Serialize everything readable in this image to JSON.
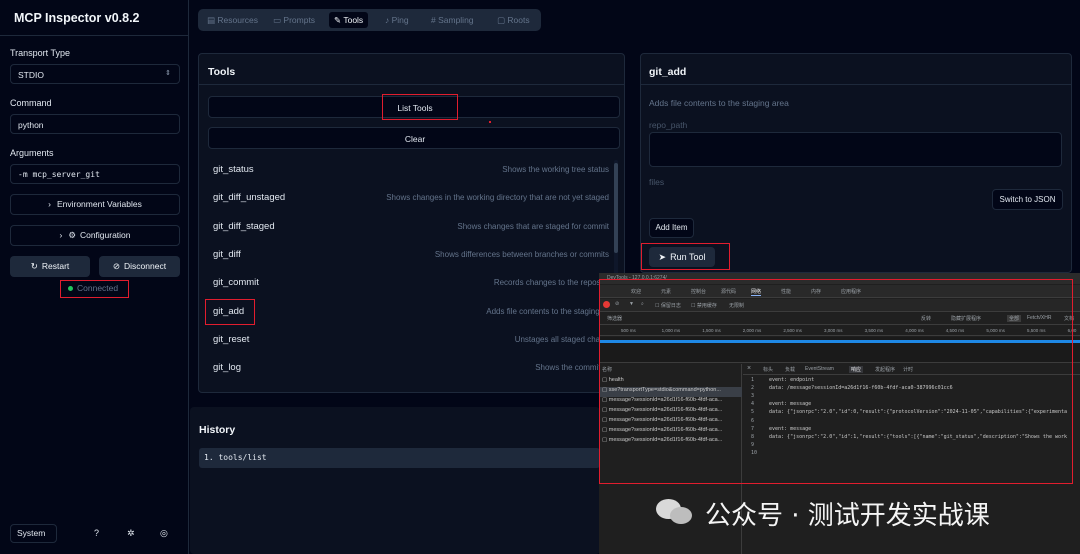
{
  "app": {
    "title": "MCP Inspector v0.8.2"
  },
  "sidebar": {
    "transport_label": "Transport Type",
    "transport_value": "STDIO",
    "command_label": "Command",
    "command_value": "python",
    "arguments_label": "Arguments",
    "arguments_value": "-m mcp_server_git",
    "env_button": "Environment Variables",
    "config_button": "Configuration",
    "restart_button": "Restart",
    "disconnect_button": "Disconnect",
    "status": "Connected",
    "theme_select": "System"
  },
  "tabs": [
    {
      "label": "Resources",
      "icon": "file-icon"
    },
    {
      "label": "Prompts",
      "icon": "chat-icon"
    },
    {
      "label": "Tools",
      "icon": "wrench-icon"
    },
    {
      "label": "Ping",
      "icon": "bell-icon"
    },
    {
      "label": "Sampling",
      "icon": "hash-icon"
    },
    {
      "label": "Roots",
      "icon": "folder-icon"
    }
  ],
  "tools_panel": {
    "title": "Tools",
    "list_button": "List Tools",
    "clear_button": "Clear",
    "items": [
      {
        "name": "git_status",
        "description": "Shows the working tree status"
      },
      {
        "name": "git_diff_unstaged",
        "description": "Shows changes in the working directory that are not yet staged"
      },
      {
        "name": "git_diff_staged",
        "description": "Shows changes that are staged for commit"
      },
      {
        "name": "git_diff",
        "description": "Shows differences between branches or commits"
      },
      {
        "name": "git_commit",
        "description": "Records changes to the reposito"
      },
      {
        "name": "git_add",
        "description": "Adds file contents to the staging ar"
      },
      {
        "name": "git_reset",
        "description": "Unstages all staged chang"
      },
      {
        "name": "git_log",
        "description": "Shows the commit lo"
      }
    ]
  },
  "history": {
    "title": "History",
    "items": [
      "1. tools/list"
    ]
  },
  "detail": {
    "title": "git_add",
    "description": "Adds file contents to the staging area",
    "repo_path_label": "repo_path",
    "files_label": "files",
    "switch_json_button": "Switch to JSON",
    "add_item_button": "Add Item",
    "run_button": "Run Tool"
  },
  "devtools": {
    "url_fragment": "DevTools - 127.0.0.1:6274/",
    "tabs": [
      "欢迎",
      "元素",
      "控制台",
      "源代码",
      "网络",
      "性能",
      "内存",
      "应用程序"
    ],
    "active_tab": "网络",
    "options": [
      "保留日志",
      "禁用缓存",
      "无限制"
    ],
    "filter_placeholder": "筛选器",
    "filter_options": [
      "反转",
      "隐藏扩展程序",
      "全部",
      "Fetch/XHR",
      "文档"
    ],
    "ticks": [
      "500 ms",
      "1,000 ms",
      "1,500 ms",
      "2,000 ms",
      "2,500 ms",
      "3,000 ms",
      "3,500 ms",
      "4,000 ms",
      "4,500 ms",
      "5,000 ms",
      "5,500 ms",
      "6,00"
    ],
    "name_header": "名称",
    "requests": [
      "health",
      "sse?transportType=stdio&command=python...",
      "message?sessionId=a26d1f16-f60b-4fdf-aca...",
      "message?sessionId=a26d1f16-f60b-4fdf-aca...",
      "message?sessionId=a26d1f16-f60b-4fdf-aca...",
      "message?sessionId=a26d1f16-f60b-4fdf-aca...",
      "message?sessionId=a26d1f16-f60b-4fdf-aca..."
    ],
    "detail_tabs": [
      "标头",
      "负载",
      "EventStream",
      "响应",
      "发起程序",
      "计时"
    ],
    "active_detail_tab": "响应",
    "response_lines": [
      {
        "n": "1",
        "text": "event: endpoint"
      },
      {
        "n": "2",
        "text": "data: /message?sessionId=a26d1f16-f60b-4fdf-aca0-387996c01cc6"
      },
      {
        "n": "3",
        "text": ""
      },
      {
        "n": "4",
        "text": "event: message"
      },
      {
        "n": "5",
        "text": "data: {\"jsonrpc\":\"2.0\",\"id\":0,\"result\":{\"protocolVersion\":\"2024-11-05\",\"capabilities\":{\"experimenta"
      },
      {
        "n": "6",
        "text": ""
      },
      {
        "n": "7",
        "text": "event: message"
      },
      {
        "n": "8",
        "text": "data: {\"jsonrpc\":\"2.0\",\"id\":1,\"result\":{\"tools\":[{\"name\":\"git_status\",\"description\":\"Shows the work"
      },
      {
        "n": "9",
        "text": ""
      },
      {
        "n": "10",
        "text": ""
      }
    ]
  },
  "watermark": {
    "text": "公众号 · 测试开发实战课"
  },
  "colors": {
    "highlight": "#e11d2e",
    "connected": "#22c55e",
    "background": "#020617",
    "panel": "#0b1120"
  }
}
